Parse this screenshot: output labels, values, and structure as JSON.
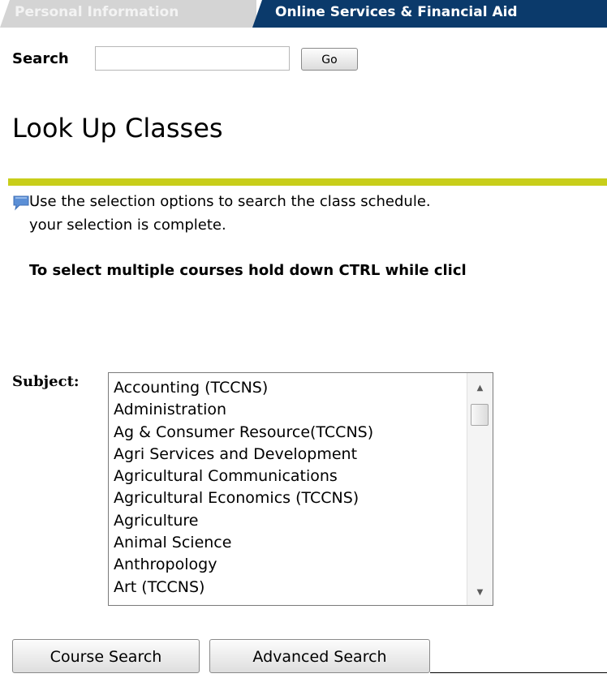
{
  "tabs": [
    {
      "label": "Personal Information",
      "active": false
    },
    {
      "label": "Online Services & Financial Aid",
      "active": true
    }
  ],
  "search": {
    "label": "Search",
    "value": "",
    "placeholder": "",
    "go_label": "Go"
  },
  "page": {
    "title": "Look Up Classes"
  },
  "info": {
    "icon": "info-speech-bubble-icon",
    "line1": "Use the selection options to search the class schedule.",
    "line2": "your selection is complete.",
    "multi_select_note": "To select multiple courses hold down CTRL while clicl"
  },
  "subject": {
    "label": "Subject:",
    "options": [
      "Accounting (TCCNS)",
      "Administration",
      "Ag & Consumer Resource(TCCNS)",
      "Agri Services and Development",
      "Agricultural Communications",
      "Agricultural Economics (TCCNS)",
      "Agriculture",
      "Animal Science",
      "Anthropology",
      "Art (TCCNS)"
    ]
  },
  "buttons": {
    "course_search": "Course Search",
    "advanced_search": "Advanced Search"
  },
  "colors": {
    "active_tab": "#0b3a6b",
    "inactive_tab": "#d4d4d4",
    "divider": "#c8ce1a"
  }
}
